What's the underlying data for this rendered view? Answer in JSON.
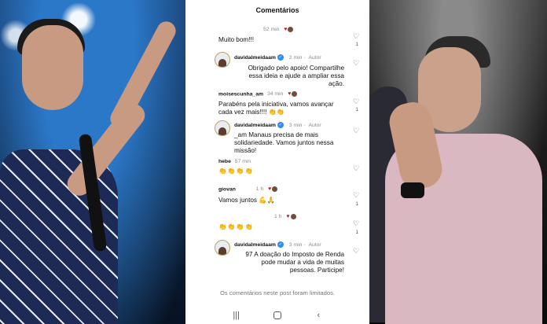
{
  "sheet": {
    "title": "Comentários"
  },
  "comments": [
    {
      "user": "",
      "time": "52 min",
      "text": "Muito bom!!!",
      "likes": "1"
    },
    {
      "user": "davidalmeidaam",
      "time": "2 min",
      "author_tag": "Autor",
      "text": "Obrigado pelo apoio! Compartilhe essa ideia e ajude a ampliar essa ação.",
      "likes": ""
    },
    {
      "user": "moisescunha_am",
      "time": "34 min",
      "text": "Parabéns pela iniciativa, vamos avançar cada vez mais!!!! 👏👏",
      "likes": "1"
    },
    {
      "user": "davidalmeidaam",
      "time": "3 min",
      "author_tag": "Autor",
      "text": "_am Manaus precisa de mais solidariedade. Vamos juntos nessa missão!",
      "likes": ""
    },
    {
      "user": "hebe",
      "time": "57 min",
      "text": "👏👏👏👏",
      "likes": ""
    },
    {
      "user": "giovan",
      "time": "1 h",
      "text": "Vamos juntos 💪🙏",
      "likes": "1"
    },
    {
      "user": "",
      "time": "1 h",
      "text": "👏👏👏👏",
      "likes": "1"
    },
    {
      "user": "davidalmeidaam",
      "time": "3 min",
      "author_tag": "Autor",
      "text": "97 A doação do Imposto de Renda pode mudar a vida de muitas pessoas. Participe!",
      "likes": ""
    }
  ],
  "footer": {
    "limit_note": "Os comentários neste post foram limitados."
  },
  "navbar": {
    "recent": "|||",
    "back": "‹"
  },
  "icons": {
    "heart": "heart-icon",
    "verified": "verified-badge-icon",
    "like_indicator": "♥"
  },
  "colors": {
    "verified": "#2f8cf3",
    "like_heart": "#d0142c"
  }
}
